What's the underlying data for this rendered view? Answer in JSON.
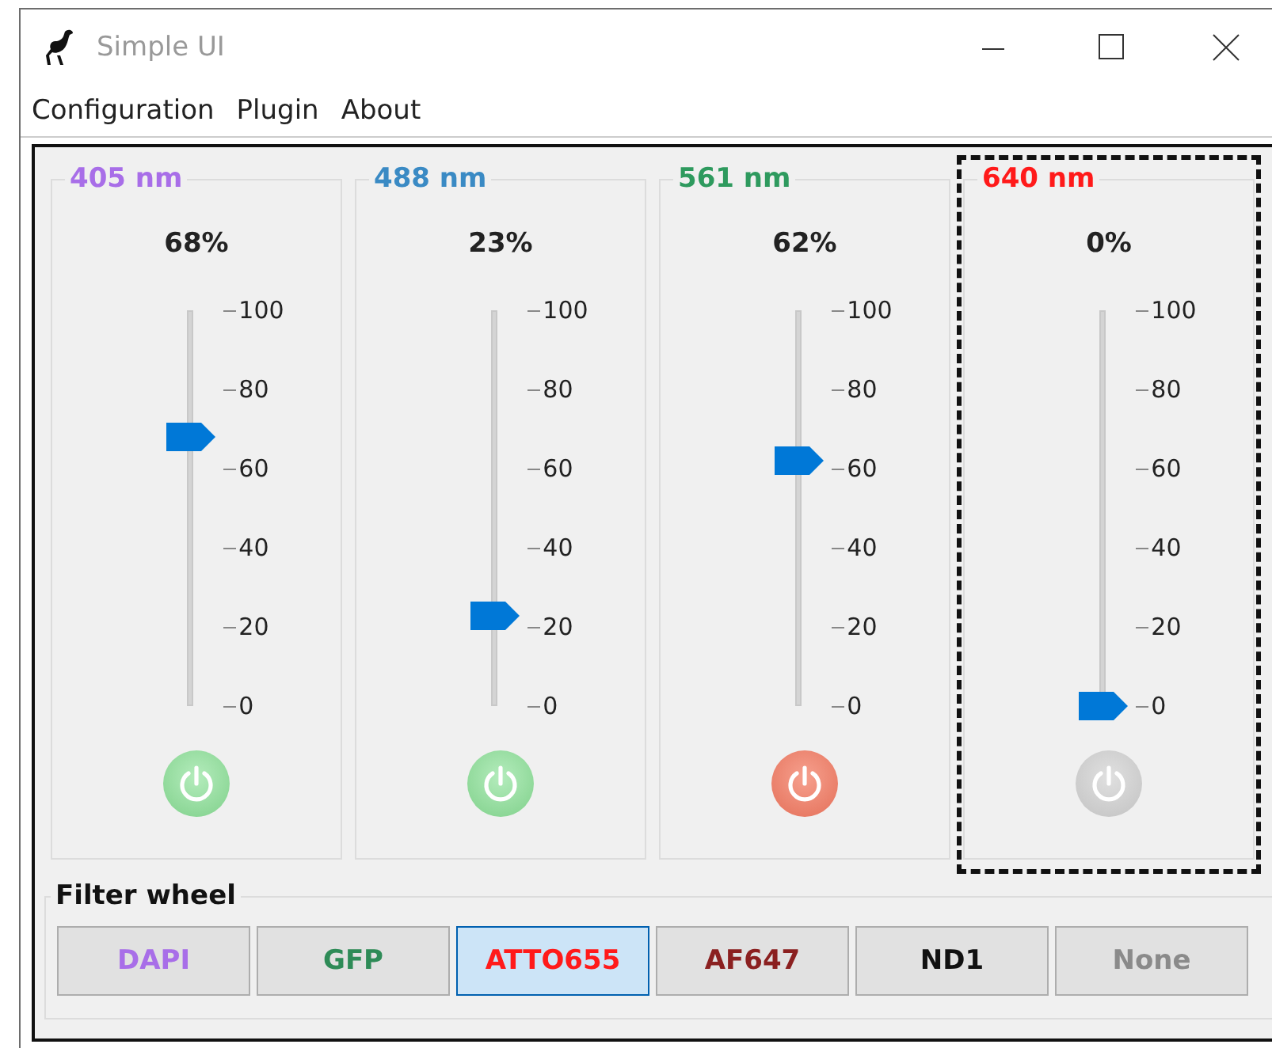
{
  "window": {
    "title": "Simple UI"
  },
  "menu": [
    "Configuration",
    "Plugin",
    "About"
  ],
  "lasers": [
    {
      "name": "405 nm",
      "color": "#a86ee8",
      "reading": "68%",
      "level": 0.68,
      "on": false,
      "disabled": false,
      "selected": false,
      "ticks": [
        "100",
        "80",
        "60",
        "40",
        "20",
        "0"
      ]
    },
    {
      "name": "488 nm",
      "color": "#3a8ac4",
      "reading": "23%",
      "level": 0.23,
      "on": false,
      "disabled": false,
      "selected": false,
      "ticks": [
        "100",
        "80",
        "60",
        "40",
        "20",
        "0"
      ]
    },
    {
      "name": "561 nm",
      "color": "#2e9a5e",
      "reading": "62%",
      "level": 0.62,
      "on": true,
      "disabled": false,
      "selected": false,
      "ticks": [
        "100",
        "80",
        "60",
        "40",
        "20",
        "0"
      ]
    },
    {
      "name": "640 nm",
      "color": "#ff1a1a",
      "reading": "0%",
      "level": 0,
      "on": false,
      "disabled": true,
      "selected": true,
      "ticks": [
        "100",
        "80",
        "60",
        "40",
        "20",
        "0"
      ]
    }
  ],
  "filter_wheel": {
    "title": "Filter wheel",
    "filters": [
      {
        "label": "DAPI",
        "color": "#a86ee8",
        "selected": false
      },
      {
        "label": "GFP",
        "color": "#2e8b57",
        "selected": false
      },
      {
        "label": "ATTO655",
        "color": "#ff1a1a",
        "selected": true
      },
      {
        "label": "AF647",
        "color": "#8b2020",
        "selected": false
      },
      {
        "label": "ND1",
        "color": "#111111",
        "selected": false
      },
      {
        "label": "None",
        "color": "#8a8a8a",
        "selected": false
      }
    ]
  }
}
